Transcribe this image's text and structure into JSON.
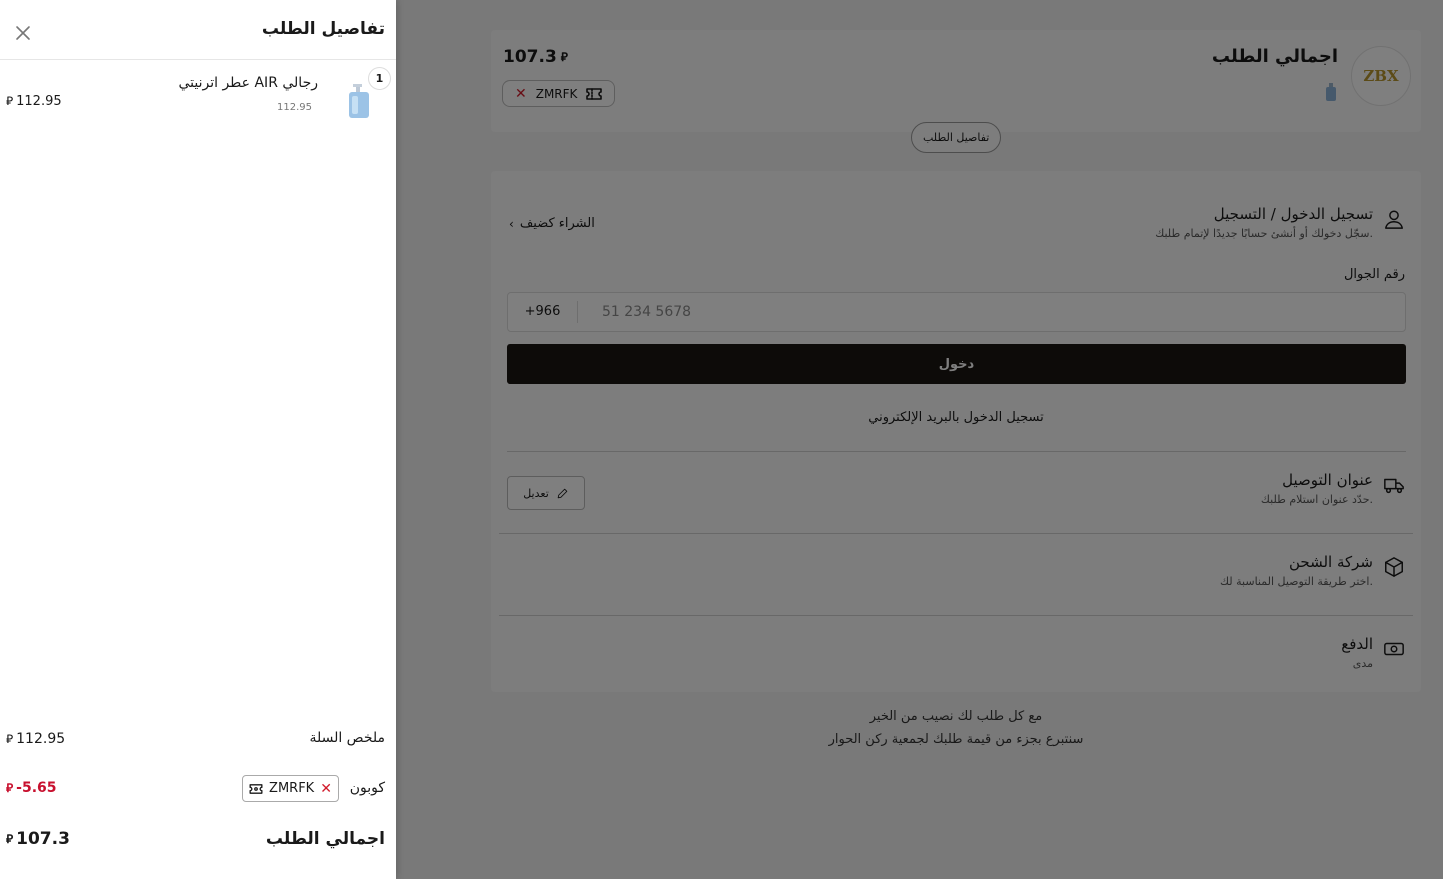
{
  "currency_symbol": "⃁",
  "summary": {
    "logo_text": "ZBX",
    "title": "اجمالي الطلب",
    "total": "107.3",
    "coupon_code": "ZMRFK",
    "details_pill": "تفاصيل الطلب"
  },
  "checkout": {
    "login_title": "تسجيل الدخول / التسجيل",
    "login_sub": "سجّل دخولك أو أنشئ حسابًا جديدًا لإتمام طلبك.",
    "guest_link": "الشراء كضيف",
    "phone_label": "رقم الجوال",
    "country_code": "+966",
    "phone_placeholder": "51 234 5678",
    "login_button": "دخول",
    "email_link": "تسجيل الدخول بالبريد الإلكتروني",
    "address_title": "عنوان التوصيل",
    "address_sub": "حدّد عنوان استلام طلبك.",
    "edit_button": "تعديل",
    "shipping_title": "شركة الشحن",
    "shipping_sub": "اختر طريقة التوصيل المناسبة لك.",
    "payment_title": "الدفع",
    "payment_sub": "مدى"
  },
  "charity": {
    "line1": "مع كل طلب لك نصيب من الخير",
    "line2": "سنتبرع بجزء من قيمة طلبك لجمعية ركن الحوار"
  },
  "drawer": {
    "title": "تفاصيل الطلب",
    "item": {
      "name": "عطر اترنيتي AIR رجالي",
      "unit_price": "112.95",
      "quantity": "1",
      "line_total": "112.95"
    },
    "subtotal_label": "ملخص السلة",
    "subtotal": "112.95",
    "coupon_label": "كوبون",
    "coupon_code": "ZMRFK",
    "discount": "-5.65",
    "total_label": "اجمالي الطلب",
    "total": "107.3"
  },
  "colors": {
    "primary_button": "#1b1612",
    "discount_red": "#c8102e",
    "overlay": "rgba(0,0,0,0.5)"
  }
}
